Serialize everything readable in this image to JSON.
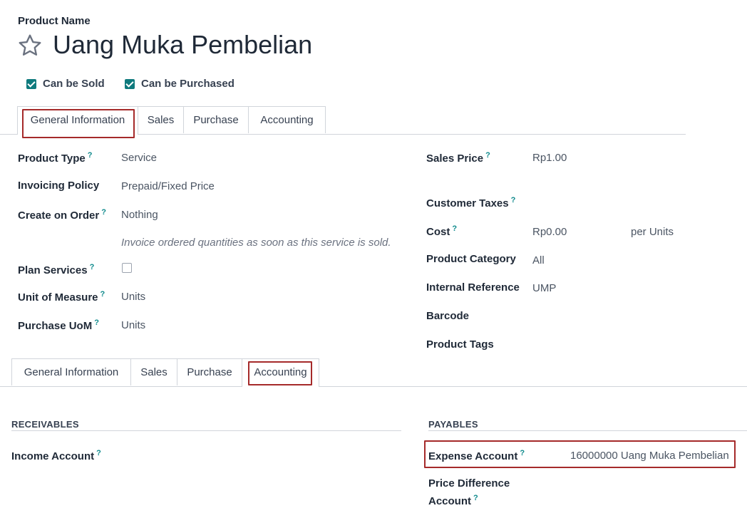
{
  "header": {
    "field_label": "Product Name",
    "product_name": "Uang Muka Pembelian"
  },
  "options": {
    "can_be_sold": "Can be Sold",
    "can_be_purchased": "Can be Purchased"
  },
  "tabs_top": [
    "General Information",
    "Sales",
    "Purchase",
    "Accounting"
  ],
  "general": {
    "product_type": {
      "label": "Product Type",
      "value": "Service"
    },
    "invoicing_policy": {
      "label": "Invoicing Policy",
      "value": "Prepaid/Fixed Price"
    },
    "create_on_order": {
      "label": "Create on Order",
      "value": "Nothing"
    },
    "hint": "Invoice ordered quantities as soon as this service is sold.",
    "plan_services": {
      "label": "Plan Services"
    },
    "unit_of_measure": {
      "label": "Unit of Measure",
      "value": "Units"
    },
    "purchase_uom": {
      "label": "Purchase UoM",
      "value": "Units"
    },
    "sales_price": {
      "label": "Sales Price",
      "value": "Rp1.00"
    },
    "customer_taxes": {
      "label": "Customer Taxes"
    },
    "cost": {
      "label": "Cost",
      "value": "Rp0.00",
      "unit": "per Units"
    },
    "product_category": {
      "label": "Product Category",
      "value": "All"
    },
    "internal_reference": {
      "label": "Internal Reference",
      "value": "UMP"
    },
    "barcode": {
      "label": "Barcode"
    },
    "product_tags": {
      "label": "Product Tags"
    }
  },
  "tabs_bottom": [
    "General Information",
    "Sales",
    "Purchase",
    "Accounting"
  ],
  "accounting": {
    "receivables_title": "RECEIVABLES",
    "income_account": {
      "label": "Income Account"
    },
    "payables_title": "PAYABLES",
    "expense_account": {
      "label": "Expense Account",
      "value": "16000000 Uang Muka Pembelian"
    },
    "price_difference_line1": "Price Difference",
    "price_difference_line2": "Account"
  },
  "help_mark": "?",
  "colors": {
    "accent": "#0f7a7d",
    "highlight_box": "#a52a2a"
  }
}
